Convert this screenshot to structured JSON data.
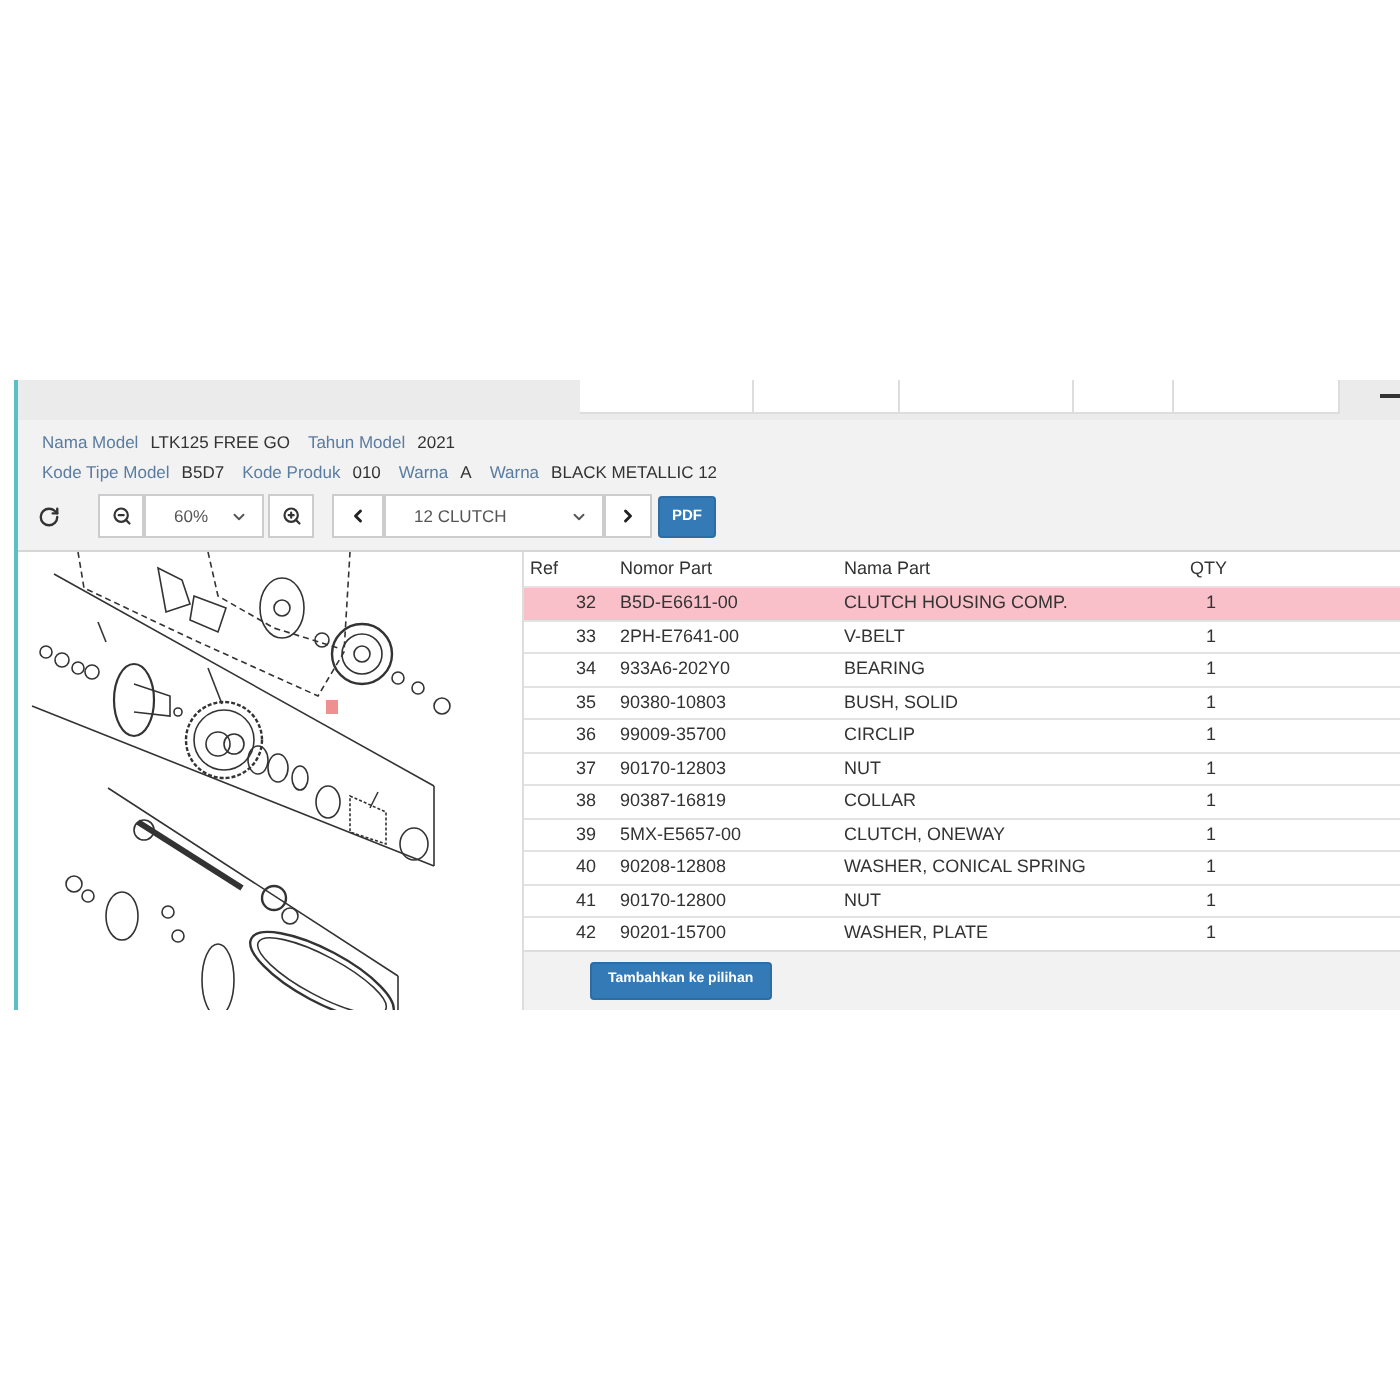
{
  "model_info": {
    "lines": [
      [
        {
          "label": "Nama Model",
          "value": "LTK125 FREE GO"
        },
        {
          "label": "Tahun Model",
          "value": "2021"
        }
      ],
      [
        {
          "label": "Kode Tipe Model",
          "value": "B5D7"
        },
        {
          "label": "Kode Produk",
          "value": "010"
        },
        {
          "label": "Warna",
          "value": "A"
        },
        {
          "label": "Warna",
          "value": "BLACK METALLIC 12"
        }
      ]
    ]
  },
  "toolbar": {
    "zoom_select": {
      "value": "60%"
    },
    "section_select": {
      "value": "12 CLUTCH"
    },
    "pdf_button": "PDF"
  },
  "table": {
    "columns": [
      "Ref",
      "Nomor Part",
      "Nama Part",
      "QTY"
    ],
    "rows": [
      {
        "ref": "32",
        "part_number": "B5D-E6611-00",
        "part_name": "CLUTCH HOUSING COMP.",
        "qty": "1",
        "selected": true
      },
      {
        "ref": "33",
        "part_number": "2PH-E7641-00",
        "part_name": "V-BELT",
        "qty": "1",
        "selected": false
      },
      {
        "ref": "34",
        "part_number": "933A6-202Y0",
        "part_name": "BEARING",
        "qty": "1",
        "selected": false
      },
      {
        "ref": "35",
        "part_number": "90380-10803",
        "part_name": "BUSH, SOLID",
        "qty": "1",
        "selected": false
      },
      {
        "ref": "36",
        "part_number": "99009-35700",
        "part_name": "CIRCLIP",
        "qty": "1",
        "selected": false
      },
      {
        "ref": "37",
        "part_number": "90170-12803",
        "part_name": "NUT",
        "qty": "1",
        "selected": false
      },
      {
        "ref": "38",
        "part_number": "90387-16819",
        "part_name": "COLLAR",
        "qty": "1",
        "selected": false
      },
      {
        "ref": "39",
        "part_number": "5MX-E5657-00",
        "part_name": "CLUTCH, ONEWAY",
        "qty": "1",
        "selected": false
      },
      {
        "ref": "40",
        "part_number": "90208-12808",
        "part_name": "WASHER, CONICAL SPRING",
        "qty": "1",
        "selected": false
      },
      {
        "ref": "41",
        "part_number": "90170-12800",
        "part_name": "NUT",
        "qty": "1",
        "selected": false
      },
      {
        "ref": "42",
        "part_number": "90201-15700",
        "part_name": "WASHER, PLATE",
        "qty": "1",
        "selected": false
      }
    ]
  },
  "add_button": "Tambahkan ke pilihan"
}
